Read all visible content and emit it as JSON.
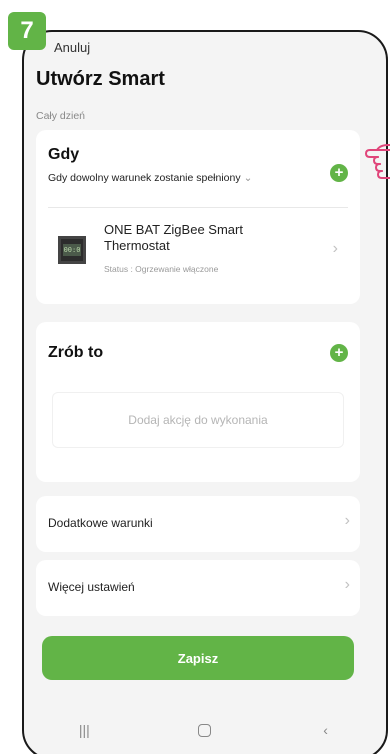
{
  "step_badge": "7",
  "header": {
    "cancel_label": "Anuluj",
    "title": "Utwórz Smart",
    "subtitle": "Cały dzień"
  },
  "when_card": {
    "title": "Gdy",
    "description": "Gdy dowolny warunek zostanie spełniony",
    "device": {
      "name": "ONE BAT ZigBee Smart Thermostat",
      "status": "Status : Ogrzewanie włączone",
      "thumb_text": "00:0"
    }
  },
  "then_card": {
    "title": "Zrób to",
    "empty_text": "Dodaj akcję do wykonania"
  },
  "rows": {
    "additional_conditions": "Dodatkowe warunki",
    "more_settings": "Więcej ustawień"
  },
  "save_label": "Zapisz",
  "colors": {
    "accent": "#62b447",
    "background": "#f4f4f4",
    "card": "#ffffff"
  },
  "icons": {
    "add": "plus-circle-icon",
    "chevron": "chevron-right-icon",
    "pointer": "hand-pointer-icon"
  }
}
